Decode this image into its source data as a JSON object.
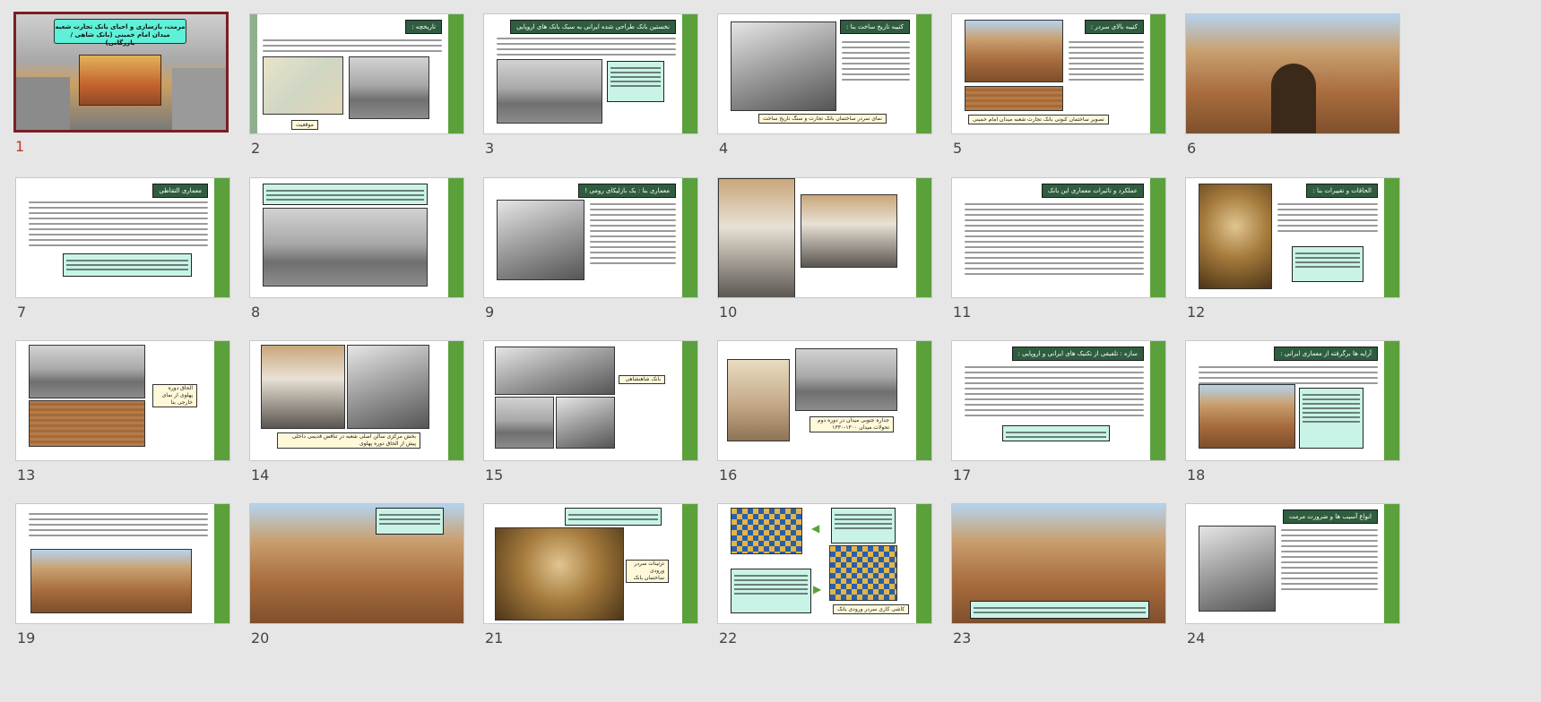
{
  "slide_sorter": {
    "selected_slide": 1,
    "slides": [
      {
        "number": "1",
        "title": "مرمت، بازسازی و احیای بانک تجارت شعبه میدان امام خمینی (بانک شاهی / بازرگانی)"
      },
      {
        "number": "2",
        "title": "تاریخچه :",
        "caption": "موقعیت"
      },
      {
        "number": "3",
        "title": "نخستین بانک طراحی شده ایرانی به سبک بانک های اروپایی"
      },
      {
        "number": "4",
        "title": "کتیبه تاریخ ساخت بنا :",
        "caption": "نمای سردر ساختمان بانک تجارت و سنگ تاریخ ساخت"
      },
      {
        "number": "5",
        "title": "کتیبه بالای سردر :",
        "caption": "تصویر ساختمان کنونی بانک تجارت شعبه میدان امام خمینی"
      },
      {
        "number": "6"
      },
      {
        "number": "7",
        "title": "معماری التقاطی"
      },
      {
        "number": "8"
      },
      {
        "number": "9",
        "title": "معماری بنا : یک بازلیکای رومی !"
      },
      {
        "number": "10"
      },
      {
        "number": "11",
        "title": "عملکرد و تاثیرات معماری این بانک"
      },
      {
        "number": "12",
        "title": "الحاقات و تغییرات بنا :"
      },
      {
        "number": "13",
        "caption": "الحاق دوره پهلوی از نمای خارجی بنا"
      },
      {
        "number": "14",
        "caption": "بخش مرکزی سالن اصلی شعبه در تناقض قدیمی داخلی پیش از الحاق دوره پهلوی"
      },
      {
        "number": "15",
        "caption": "بانک شاهنشاهی"
      },
      {
        "number": "16",
        "caption": "جداره جنوبی میدان در دوره دوم تحولات میدان ۱۳۰۰-۱۳۳۰"
      },
      {
        "number": "17",
        "title": "سازه : تلفیقی از تکنیک های ایرانی و اروپایی :"
      },
      {
        "number": "18",
        "title": "آرایه ها برگرفته از معماری ایرانی :"
      },
      {
        "number": "19"
      },
      {
        "number": "20"
      },
      {
        "number": "21",
        "caption": "تزئینات سردر ورودی ساختمان بانک"
      },
      {
        "number": "22",
        "caption": "کاشی کاری سردر ورودی بانک"
      },
      {
        "number": "23"
      },
      {
        "number": "24",
        "title": "انواع آسیب ها و ضرورت مرمت"
      }
    ]
  },
  "colors": {
    "background": "#e6e6e6",
    "accent_green": "#5aa13c",
    "title_green": "#2f5d3f",
    "note_cyan": "#c9f3e7",
    "selected_border": "#7a1f22",
    "selected_number": "#c0392b"
  }
}
